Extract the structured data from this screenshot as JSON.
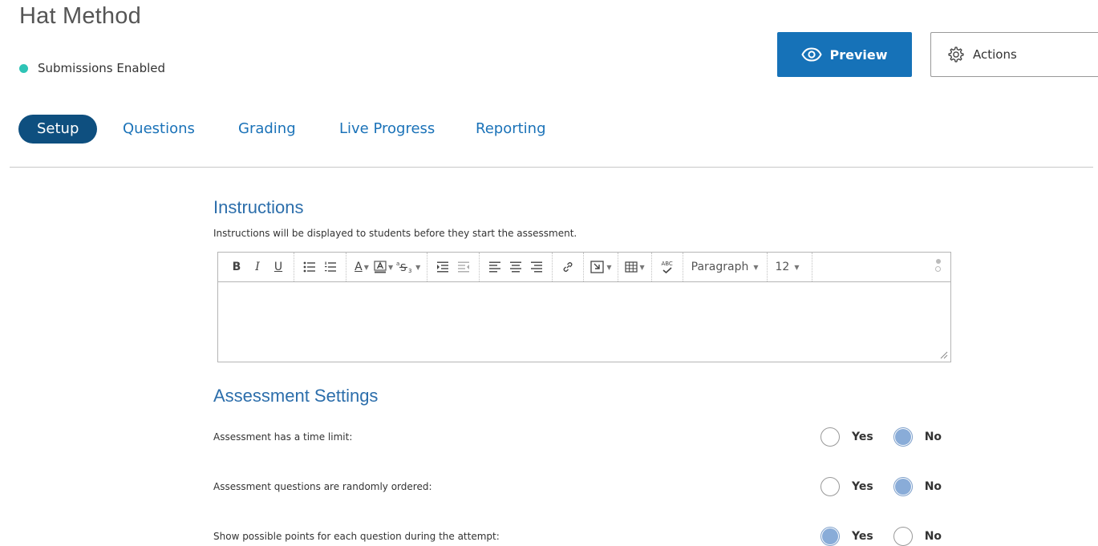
{
  "header": {
    "title": "Hat Method",
    "status_text": "Submissions Enabled",
    "status_color": "#2ec4b6",
    "preview_label": "Preview",
    "preview_icon": "eye-icon",
    "actions_label": "Actions",
    "actions_icon": "gear-icon"
  },
  "tabs": [
    {
      "label": "Setup",
      "active": true
    },
    {
      "label": "Questions",
      "active": false
    },
    {
      "label": "Grading",
      "active": false
    },
    {
      "label": "Live Progress",
      "active": false
    },
    {
      "label": "Reporting",
      "active": false
    }
  ],
  "instructions": {
    "title": "Instructions",
    "description": "Instructions will be displayed to students before they start the assessment.",
    "editor_value": "",
    "toolbar": {
      "bold": "B",
      "italic": "I",
      "underline": "U",
      "font_color": "A",
      "paragraph": "Paragraph",
      "font_size": "12",
      "spellcheck": "ABC"
    }
  },
  "settings": {
    "title": "Assessment Settings",
    "yes_label": "Yes",
    "no_label": "No",
    "items": [
      {
        "label": "Assessment has a time limit:",
        "selected": "No"
      },
      {
        "label": "Assessment questions are randomly ordered:",
        "selected": "No"
      },
      {
        "label": "Show possible points for each question during the attempt:",
        "selected": "Yes"
      }
    ]
  },
  "colors": {
    "primary": "#1672b8",
    "active_tab": "#0e4f7f",
    "link": "#1a72b8",
    "radio_selected": "#89acd8"
  }
}
